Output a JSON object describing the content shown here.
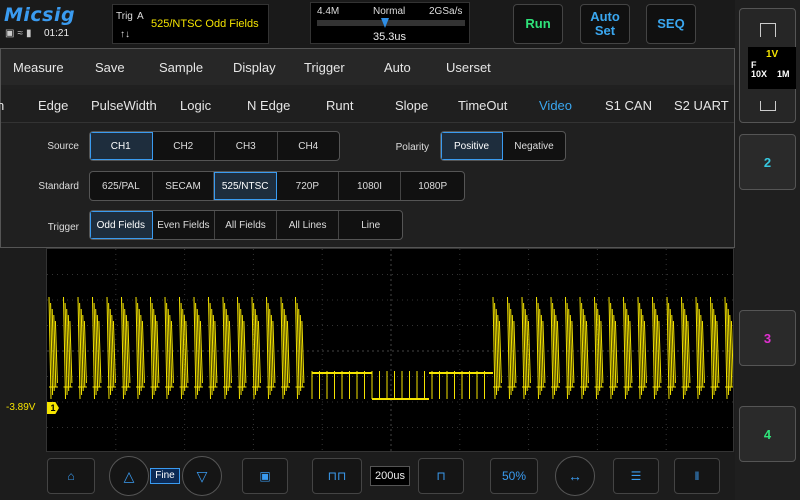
{
  "app": {
    "logo": "Micsig",
    "clock": "01:21",
    "status_icons": [
      "monitor-icon",
      "wifi-icon",
      "battery-icon"
    ]
  },
  "trigger_status": {
    "label": "Trig",
    "channel": "A",
    "description": "525/NTSC Odd Fields"
  },
  "timebase": {
    "memory_depth": "4.4M",
    "mode": "Normal",
    "sample_rate": "2GSa/s",
    "position": "35.3us"
  },
  "top_buttons": {
    "run": "Run",
    "auto_set_line1": "Auto",
    "auto_set_line2": "Set",
    "seq": "SEQ"
  },
  "menu": {
    "tabs": [
      "Measure",
      "Save",
      "Sample",
      "Display",
      "Trigger",
      "Auto",
      "Userset"
    ],
    "trigger_types": [
      "n",
      "Edge",
      "PulseWidth",
      "Logic",
      "N Edge",
      "Runt",
      "Slope",
      "TimeOut",
      "Video",
      "S1 CAN",
      "S2 UART"
    ],
    "active_trigger_type": "Video"
  },
  "video_trigger": {
    "source_label": "Source",
    "source_options": [
      "CH1",
      "CH2",
      "CH3",
      "CH4"
    ],
    "source_selected": "CH1",
    "polarity_label": "Polarity",
    "polarity_options": [
      "Positive",
      "Negative"
    ],
    "polarity_selected": "Positive",
    "standard_label": "Standard",
    "standard_options": [
      "625/PAL",
      "SECAM",
      "525/NTSC",
      "720P",
      "1080I",
      "1080P"
    ],
    "standard_selected": "525/NTSC",
    "trigger_label": "Trigger",
    "trigger_options": [
      "Odd Fields",
      "Even Fields",
      "All Fields",
      "All Lines",
      "Line"
    ],
    "trigger_selected": "Odd Fields"
  },
  "channels": {
    "ch1": {
      "volts_div": "1V",
      "coupling": "F",
      "probe": "10X",
      "bandwidth": "1M",
      "offset_label": "-3.89V",
      "marker": "1",
      "color": "#f5e400"
    },
    "ch2": {
      "label": "2",
      "color": "#36c8e0"
    },
    "ch3": {
      "label": "3",
      "color": "#e030d0"
    },
    "ch4": {
      "label": "4",
      "color": "#2fe37a"
    }
  },
  "bottom_bar": {
    "fine_label": "Fine",
    "timebase_value": "200us",
    "zoom_label": "50%",
    "icons": [
      "home-icon",
      "up-arrow-icon",
      "down-arrow-icon",
      "save-icon",
      "wave-narrow-icon",
      "wave-wide-icon",
      "measure-icon",
      "menu-icon",
      "cursor-icon"
    ]
  }
}
